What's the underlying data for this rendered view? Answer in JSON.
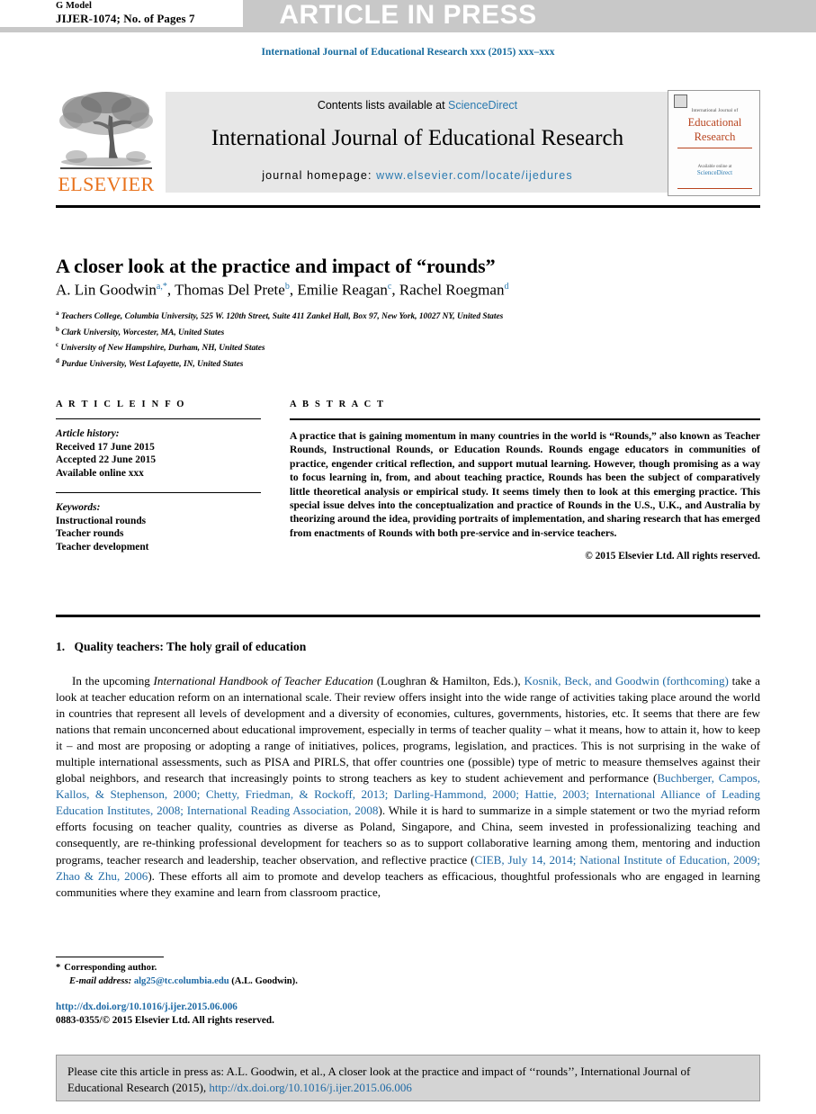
{
  "topband": {
    "gmodel_line1": "G Model",
    "gmodel_line2": "JIJER-1074; No. of Pages 7",
    "banner": "ARTICLE IN PRESS"
  },
  "running_head": "International Journal of Educational Research xxx (2015) xxx–xxx",
  "masthead": {
    "publisher_wordmark": "ELSEVIER",
    "contents_prefix": "Contents lists available at ",
    "contents_link": "ScienceDirect",
    "journal_title": "International Journal of Educational Research",
    "homepage_prefix": "journal homepage: ",
    "homepage_url": "www.elsevier.com/locate/ijedures",
    "cover": {
      "superline": "International Journal of",
      "title_line1": "Educational",
      "title_line2": "Research",
      "available_label": "Available online at",
      "sciencedirect": "ScienceDirect"
    }
  },
  "article": {
    "title": "A closer look at the practice and impact of “rounds”",
    "authors": [
      {
        "name": "A. Lin Goodwin",
        "marks": "a,*"
      },
      {
        "name": "Thomas Del Prete",
        "marks": "b"
      },
      {
        "name": "Emilie Reagan",
        "marks": "c"
      },
      {
        "name": "Rachel Roegman",
        "marks": "d"
      }
    ],
    "affiliations": [
      {
        "mark": "a",
        "text": "Teachers College, Columbia University, 525 W. 120th Street, Suite 411 Zankel Hall, Box 97, New York, 10027 NY, United States"
      },
      {
        "mark": "b",
        "text": "Clark University, Worcester, MA, United States"
      },
      {
        "mark": "c",
        "text": "University of New Hampshire, Durham, NH, United States"
      },
      {
        "mark": "d",
        "text": "Purdue University, West Lafayette, IN, United States"
      }
    ]
  },
  "article_info": {
    "heading": "A R T I C L E   I N F O",
    "history_label": "Article history:",
    "history": [
      "Received 17 June 2015",
      "Accepted 22 June 2015",
      "Available online xxx"
    ],
    "keywords_label": "Keywords:",
    "keywords": [
      "Instructional rounds",
      "Teacher rounds",
      "Teacher development"
    ]
  },
  "abstract": {
    "heading": "A B S T R A C T",
    "text": "A practice that is gaining momentum in many countries in the world is “Rounds,” also known as Teacher Rounds, Instructional Rounds, or Education Rounds. Rounds engage educators in communities of practice, engender critical reflection, and support mutual learning. However, though promising as a way to focus learning in, from, and about teaching practice, Rounds has been the subject of comparatively little theoretical analysis or empirical study. It seems timely then to look at this emerging practice. This special issue delves into the conceptualization and practice of Rounds in the U.S., U.K., and Australia by theorizing around the idea, providing portraits of implementation, and sharing research that has emerged from enactments of Rounds with both pre-service and in-service teachers.",
    "copyright": "© 2015 Elsevier Ltd. All rights reserved."
  },
  "body": {
    "section_number": "1.",
    "section_title": "Quality teachers: The holy grail of education",
    "paragraph_parts": [
      {
        "type": "text",
        "value": "In the upcoming "
      },
      {
        "type": "italic",
        "value": "International Handbook of Teacher Education"
      },
      {
        "type": "text",
        "value": " (Loughran & Hamilton, Eds.), "
      },
      {
        "type": "cite",
        "value": "Kosnik, Beck, and Goodwin (forthcoming)"
      },
      {
        "type": "text",
        "value": " take a look at teacher education reform on an international scale. Their review offers insight into the wide range of activities taking place around the world in countries that represent all levels of development and a diversity of economies, cultures, governments, histories, etc. It seems that there are few nations that remain unconcerned about educational improvement, especially in terms of teacher quality – what it means, how to attain it, how to keep it – and most are proposing or adopting a range of initiatives, polices, programs, legislation, and practices. This is not surprising in the wake of multiple international assessments, such as PISA and PIRLS, that offer countries one (possible) type of metric to measure themselves against their global neighbors, and research that increasingly points to strong teachers as key to student achievement and performance ("
      },
      {
        "type": "cite",
        "value": "Buchberger, Campos, Kallos, & Stephenson, 2000; Chetty, Friedman, & Rockoff, 2013; Darling-Hammond, 2000; Hattie, 2003; International Alliance of Leading Education Institutes, 2008; International Reading Association, 2008"
      },
      {
        "type": "text",
        "value": "). While it is hard to summarize in a simple statement or two the myriad reform efforts focusing on teacher quality, countries as diverse as Poland, Singapore, and China, seem invested in professionalizing teaching and consequently, are re-thinking professional development for teachers so as to support collaborative learning among them, mentoring and induction programs, teacher research and leadership, teacher observation, and reflective practice ("
      },
      {
        "type": "cite",
        "value": "CIEB, July 14, 2014; National Institute of Education, 2009; Zhao & Zhu, 2006"
      },
      {
        "type": "text",
        "value": "). These efforts all aim to promote and develop teachers as efficacious, thoughtful professionals who are engaged in learning communities where they examine and learn from classroom practice,"
      }
    ]
  },
  "footnote": {
    "star": "*",
    "corresponding": "Corresponding author.",
    "email_label": "E-mail address:",
    "email": "alg25@tc.columbia.edu",
    "email_owner": "(A.L. Goodwin).",
    "doi": "http://dx.doi.org/10.1016/j.ijer.2015.06.006",
    "issn": "0883-0355/© 2015 Elsevier Ltd. All rights reserved."
  },
  "citation_box": {
    "text_before": "Please cite this article in press as: A.L. Goodwin, et al., A closer look at the practice and impact of ‘‘rounds’’, International Journal of Educational Research (2015), ",
    "link": "http://dx.doi.org/10.1016/j.ijer.2015.06.006"
  },
  "colors": {
    "link": "#1f6aa5",
    "elsevier_orange": "#e8721c",
    "cover_rust": "#b8441f",
    "band_gray": "#c8c8c8",
    "masthead_gray": "#e7e7e7",
    "citation_box_gray": "#d4d4d4"
  }
}
